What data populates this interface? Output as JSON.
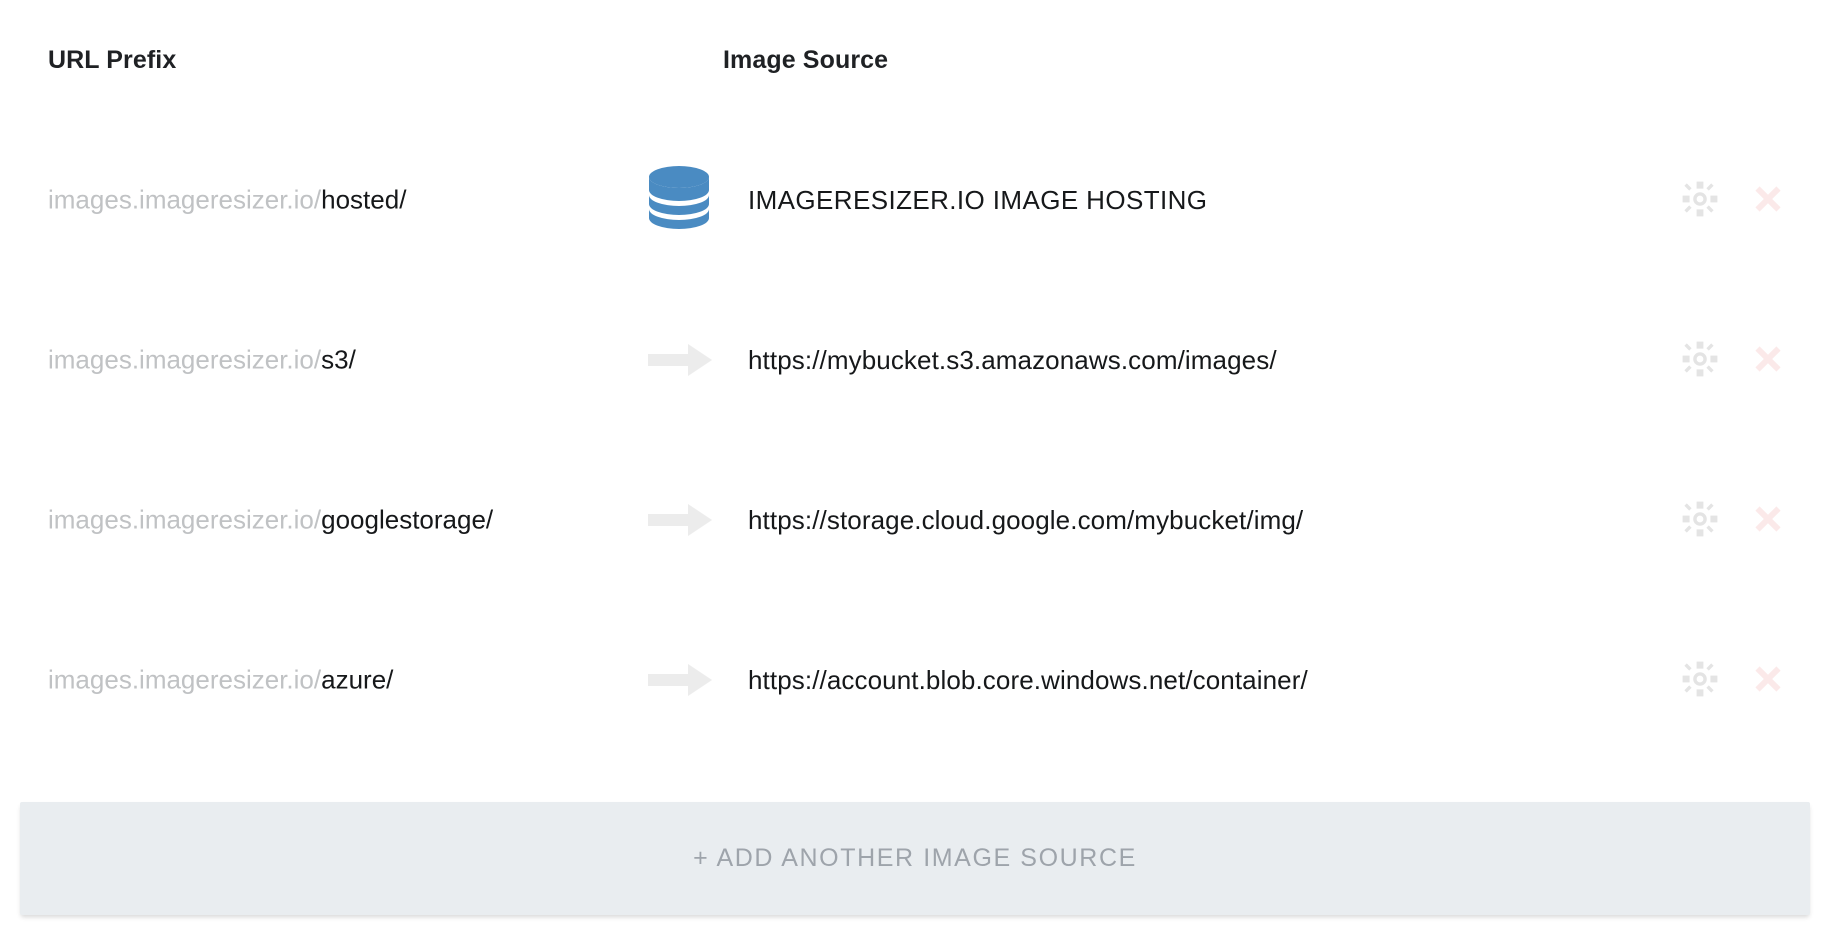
{
  "table": {
    "columns": {
      "url_prefix": "URL Prefix",
      "image_source": "Image Source"
    },
    "rows": [
      {
        "prefix_base": "images.imageresizer.io/",
        "prefix_slug": "hosted/",
        "lead_icon": "database-icon",
        "source_text": "IMAGERESIZER.IO IMAGE HOSTING",
        "source_is_caps": true,
        "settings_icon": "gear-icon",
        "remove_icon": "close-x-icon"
      },
      {
        "prefix_base": "images.imageresizer.io/",
        "prefix_slug": "s3/",
        "lead_icon": "arrow-right-icon",
        "source_text": "https://mybucket.s3.amazonaws.com/images/",
        "source_is_caps": false,
        "settings_icon": "gear-icon",
        "remove_icon": "close-x-icon"
      },
      {
        "prefix_base": "images.imageresizer.io/",
        "prefix_slug": "googlestorage/",
        "lead_icon": "arrow-right-icon",
        "source_text": "https://storage.cloud.google.com/mybucket/img/",
        "source_is_caps": false,
        "settings_icon": "gear-icon",
        "remove_icon": "close-x-icon"
      },
      {
        "prefix_base": "images.imageresizer.io/",
        "prefix_slug": "azure/",
        "lead_icon": "arrow-right-icon",
        "source_text": "https://account.blob.core.windows.net/container/",
        "source_is_caps": false,
        "settings_icon": "gear-icon",
        "remove_icon": "close-x-icon"
      }
    ]
  },
  "add_source_button": {
    "label": "+ ADD ANOTHER IMAGE SOURCE"
  },
  "colors": {
    "page_background": "#ffffff",
    "header_text": "#1f2124",
    "prefix_base_text": "#c0c2c4",
    "prefix_slug_text": "#16181a",
    "source_text": "#16181a",
    "database_icon": "#4a8bc2",
    "arrow_icon": "#ececec",
    "gear_icon": "#e4e4e4",
    "remove_icon": "#fbe9e9",
    "add_button_background": "#e9edf0",
    "add_button_text": "#9ea4ab"
  }
}
